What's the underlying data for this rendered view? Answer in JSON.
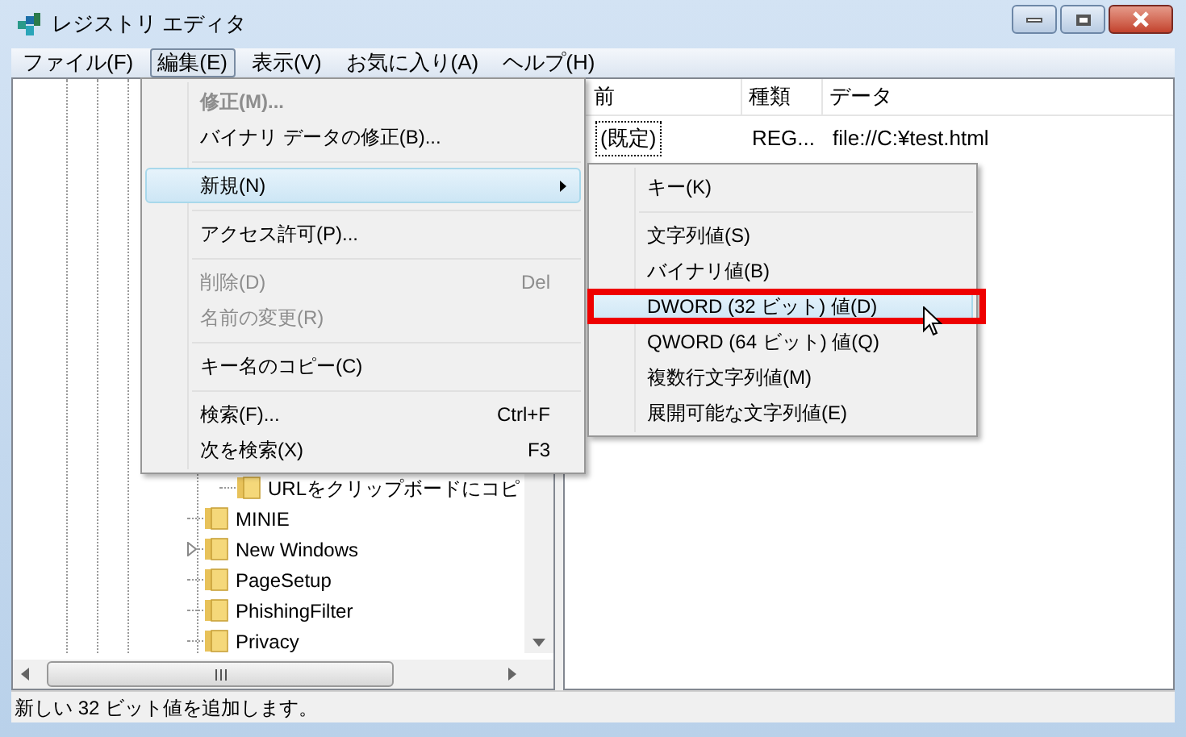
{
  "window": {
    "title": "レジストリ エディタ"
  },
  "menu_bar": [
    {
      "label": "ファイル(F)",
      "selected": false
    },
    {
      "label": "編集(E)",
      "selected": true
    },
    {
      "label": "表示(V)",
      "selected": false
    },
    {
      "label": "お気に入り(A)",
      "selected": false
    },
    {
      "label": "ヘルプ(H)",
      "selected": false
    }
  ],
  "tree": {
    "items": [
      {
        "children": [
          {
            "label": "URLをクリップボードにコピ",
            "expandable": false
          }
        ]
      },
      {
        "label": "MINIE",
        "expandable": false
      },
      {
        "label": "New Windows",
        "expandable": true
      },
      {
        "label": "PageSetup",
        "expandable": false
      },
      {
        "label": "PhishingFilter",
        "expandable": false
      },
      {
        "label": "Privacy",
        "expandable": false
      }
    ]
  },
  "list": {
    "columns": [
      "前",
      "種類",
      "データ"
    ],
    "rows": [
      {
        "cells": [
          "(既定)",
          "REG...",
          "file://C:¥test.html"
        ],
        "focused": true
      }
    ]
  },
  "edit_menu": {
    "items": [
      {
        "kind": "item",
        "label": "修正(M)...",
        "disabled": true,
        "bold": true,
        "selected": false
      },
      {
        "kind": "item",
        "label": "バイナリ データの修正(B)...",
        "disabled": false,
        "selected": false
      },
      {
        "kind": "separator"
      },
      {
        "kind": "item",
        "label": "新規(N)",
        "disabled": false,
        "selected": true,
        "submenu": true
      },
      {
        "kind": "separator"
      },
      {
        "kind": "item",
        "label": "アクセス許可(P)...",
        "disabled": false,
        "selected": false
      },
      {
        "kind": "separator"
      },
      {
        "kind": "item",
        "label": "削除(D)",
        "shortcut": "Del",
        "disabled": true,
        "selected": false
      },
      {
        "kind": "item",
        "label": "名前の変更(R)",
        "disabled": true,
        "selected": false
      },
      {
        "kind": "separator"
      },
      {
        "kind": "item",
        "label": "キー名のコピー(C)",
        "disabled": false,
        "selected": false
      },
      {
        "kind": "separator"
      },
      {
        "kind": "item",
        "label": "検索(F)...",
        "shortcut": "Ctrl+F",
        "disabled": false,
        "selected": false
      },
      {
        "kind": "item",
        "label": "次を検索(X)",
        "shortcut": "F3",
        "disabled": false,
        "selected": false
      }
    ]
  },
  "new_submenu": {
    "items": [
      {
        "kind": "item",
        "label": "キー(K)",
        "disabled": false,
        "selected": false
      },
      {
        "kind": "separator"
      },
      {
        "kind": "item",
        "label": "文字列値(S)",
        "disabled": false,
        "selected": false
      },
      {
        "kind": "item",
        "label": "バイナリ値(B)",
        "disabled": false,
        "selected": false
      },
      {
        "kind": "item",
        "label": "DWORD (32 ビット) 値(D)",
        "disabled": false,
        "selected": true
      },
      {
        "kind": "item",
        "label": "QWORD (64 ビット) 値(Q)",
        "disabled": false,
        "selected": false
      },
      {
        "kind": "item",
        "label": "複数行文字列値(M)",
        "disabled": false,
        "selected": false
      },
      {
        "kind": "item",
        "label": "展開可能な文字列値(E)",
        "disabled": false,
        "selected": false
      }
    ]
  },
  "status_bar": {
    "text": "新しい 32 ビット値を追加します。"
  }
}
